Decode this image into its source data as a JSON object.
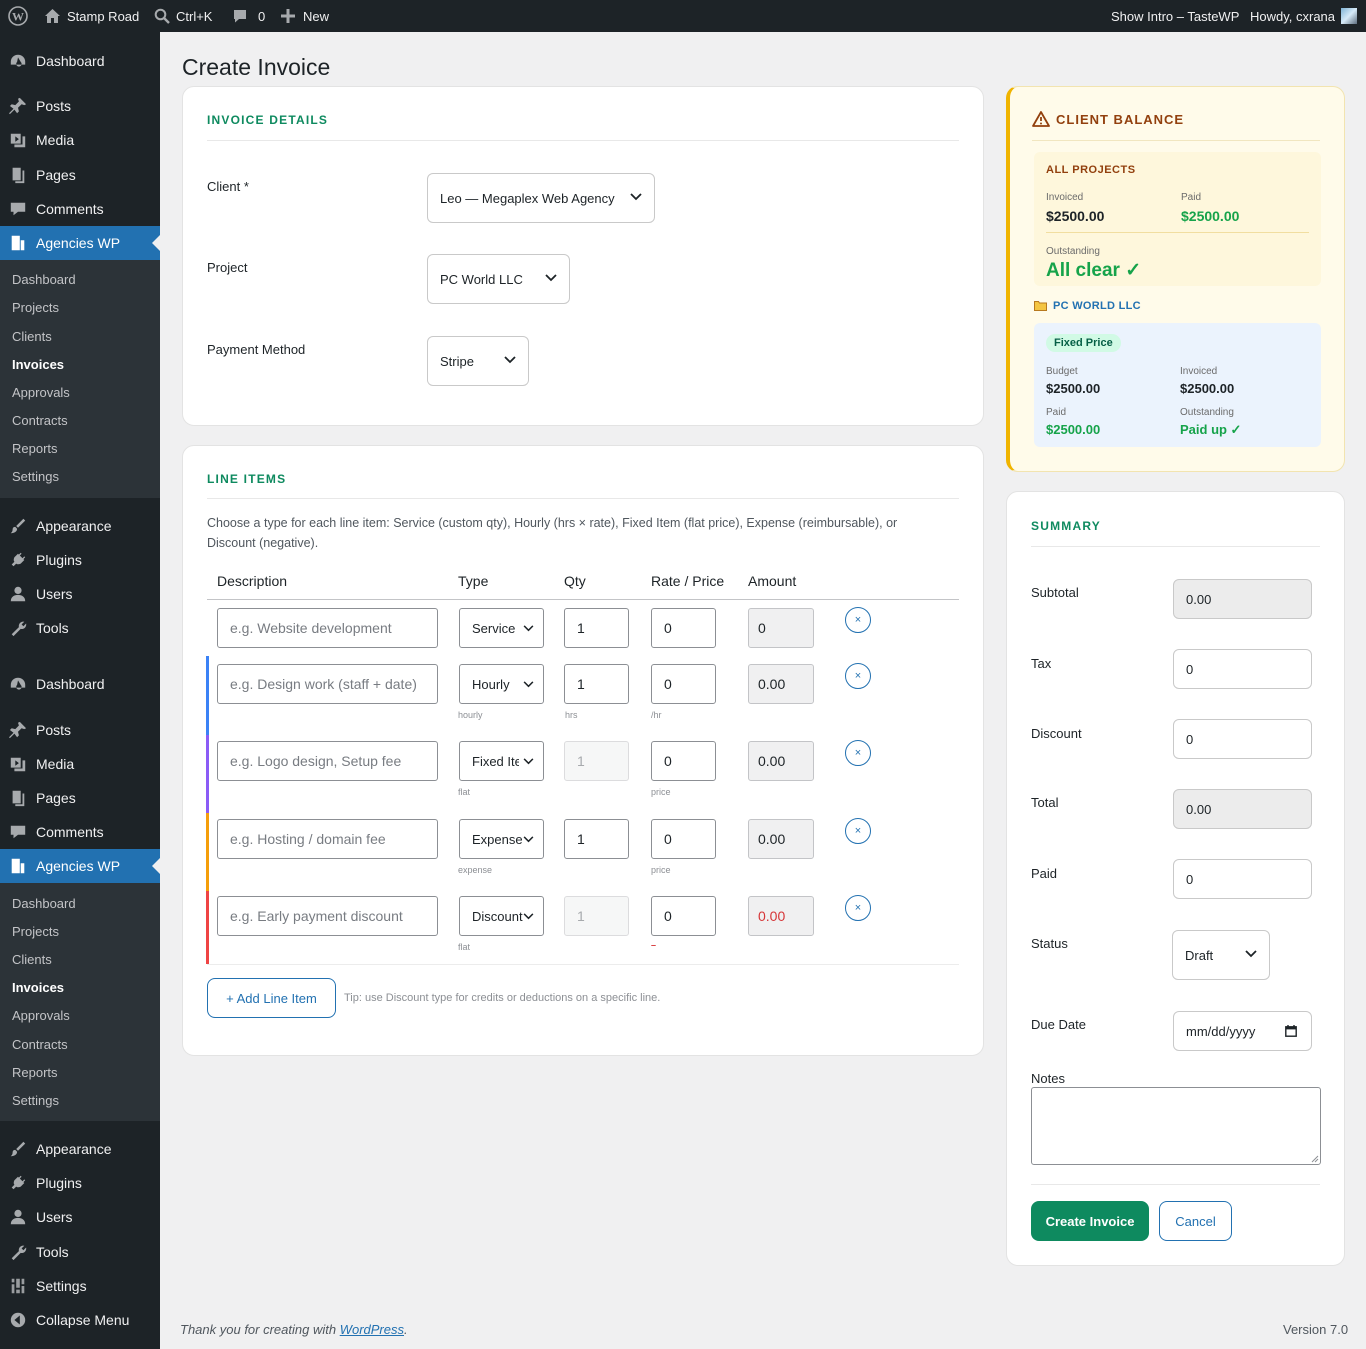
{
  "adminbar": {
    "site": "Stamp Road",
    "search": "Ctrl+K",
    "comments": "0",
    "new": "New",
    "intro": "Show Intro – TasteWP",
    "howdy": "Howdy, cxrana"
  },
  "menu": {
    "dashboard": "Dashboard",
    "posts": "Posts",
    "media": "Media",
    "pages": "Pages",
    "comments": "Comments",
    "agencies": "Agencies WP",
    "sub": [
      "Dashboard",
      "Projects",
      "Clients",
      "Invoices",
      "Approvals",
      "Contracts",
      "Reports",
      "Settings"
    ],
    "appearance": "Appearance",
    "plugins": "Plugins",
    "users": "Users",
    "tools": "Tools",
    "settings": "Settings",
    "collapse": "Collapse Menu"
  },
  "page": {
    "title": "Create Invoice"
  },
  "details": {
    "heading": "INVOICE DETAILS",
    "client_label": "Client *",
    "client_value": "Leo — Megaplex Web Agency",
    "project_label": "Project",
    "project_value": "PC World LLC",
    "payment_label": "Payment Method",
    "payment_value": "Stripe"
  },
  "lines": {
    "heading": "LINE ITEMS",
    "intro": "Choose a type for each line item: Service (custom qty), Hourly (hrs × rate), Fixed Item (flat price), Expense (reimbursable), or Discount (negative).",
    "columns": [
      "Description",
      "Type",
      "Qty",
      "Rate / Price",
      "Amount"
    ],
    "rows": [
      {
        "placeholder": "e.g. Website development",
        "type": "Service",
        "qty": "1",
        "rate": "0",
        "amount": "0",
        "hint_type": "",
        "hint_qty": "",
        "hint_rate": ""
      },
      {
        "placeholder": "e.g. Design work (staff + date)",
        "type": "Hourly",
        "qty": "1",
        "rate": "0",
        "amount": "0.00",
        "hint_type": "hourly",
        "hint_qty": "hrs",
        "hint_rate": "/hr"
      },
      {
        "placeholder": "e.g. Logo design, Setup fee",
        "type": "Fixed Item",
        "qty": "1",
        "rate": "0",
        "amount": "0.00",
        "hint_type": "flat",
        "hint_qty": "",
        "hint_rate": "price"
      },
      {
        "placeholder": "e.g. Hosting / domain fee",
        "type": "Expense",
        "qty": "1",
        "rate": "0",
        "amount": "0.00",
        "hint_type": "expense",
        "hint_qty": "",
        "hint_rate": "price"
      },
      {
        "placeholder": "e.g. Early payment discount",
        "type": "Discount",
        "qty": "1",
        "rate": "0",
        "amount": "0.00",
        "hint_type": "flat",
        "hint_qty": "",
        "hint_rate": "–"
      }
    ],
    "remove": "×",
    "add_label": "+ Add Line Item",
    "tip": "Tip: use Discount type for credits or deductions on a specific line."
  },
  "balance": {
    "heading": "CLIENT BALANCE",
    "all_projects": "ALL PROJECTS",
    "invoiced_label": "Invoiced",
    "invoiced": "$2500.00",
    "paid_label": "Paid",
    "paid": "$2500.00",
    "outstanding_label": "Outstanding",
    "outstanding": "All clear ✓",
    "project_name": "PC WORLD LLC",
    "badge": "Fixed Price",
    "budget_label": "Budget",
    "budget": "$2500.00",
    "p_invoiced_label": "Invoiced",
    "p_invoiced": "$2500.00",
    "p_paid_label": "Paid",
    "p_paid": "$2500.00",
    "p_out_label": "Outstanding",
    "p_out": "Paid up ✓"
  },
  "summary": {
    "heading": "SUMMARY",
    "subtotal_label": "Subtotal",
    "subtotal": "0.00",
    "tax_label": "Tax",
    "tax": "0",
    "discount_label": "Discount",
    "discount": "0",
    "total_label": "Total",
    "total": "0.00",
    "paid_label": "Paid",
    "paid": "0",
    "status_label": "Status",
    "status": "Draft",
    "due_label": "Due Date",
    "due_placeholder": "mm/dd/yyyy",
    "notes_label": "Notes",
    "create": "Create Invoice",
    "cancel": "Cancel"
  },
  "footer": {
    "thanks": "Thank you for creating with ",
    "wp": "WordPress",
    "dot": ".",
    "version": "Version 7.0"
  },
  "colors": {
    "accent": "#0e8a5f",
    "admin_blue": "#2271b1",
    "service": "#ffffff",
    "hourly": "#3b82f6",
    "fixed": "#8b5cf6",
    "expense": "#f59e0b",
    "discount": "#ef4444"
  }
}
